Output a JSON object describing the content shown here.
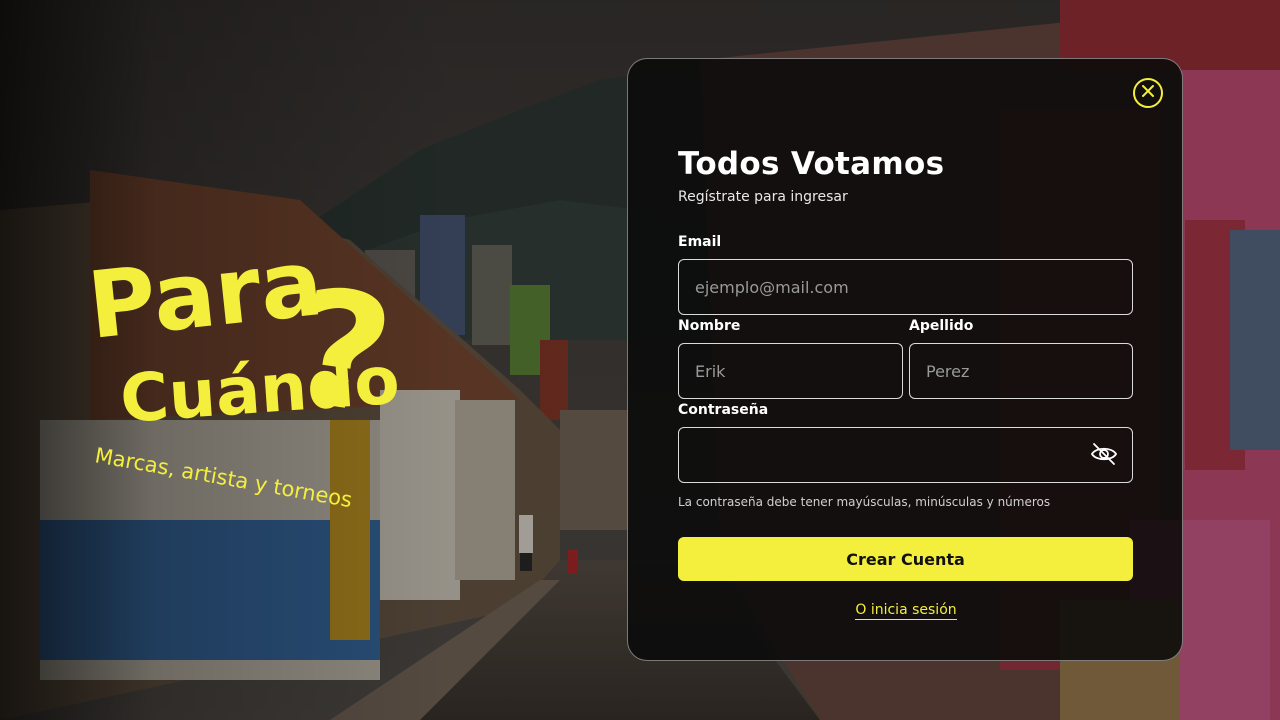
{
  "logo": {
    "line1": "Para",
    "line2": "Cuándo",
    "mark": "?",
    "tagline": "Marcas, artista y torneos",
    "color": "#f4ef3d"
  },
  "modal": {
    "title": "Todos Votamos",
    "subtitle": "Regístrate para ingresar",
    "close_icon": "close-icon",
    "email": {
      "label": "Email",
      "placeholder": "ejemplo@mail.com",
      "value": ""
    },
    "first_name": {
      "label": "Nombre",
      "placeholder": "Erik",
      "value": ""
    },
    "last_name": {
      "label": "Apellido",
      "placeholder": "Perez",
      "value": ""
    },
    "password": {
      "label": "Contraseña",
      "placeholder": "",
      "value": "",
      "toggle_icon": "eye-off-icon"
    },
    "password_hint": "La contraseña debe tener mayúsculas, minúsculas y números",
    "submit_label": "Crear Cuenta",
    "login_link": "O inicia sesión"
  },
  "colors": {
    "accent": "#f4ef3d",
    "modal_bg": "#0a0a0a",
    "text": "#ffffff"
  }
}
